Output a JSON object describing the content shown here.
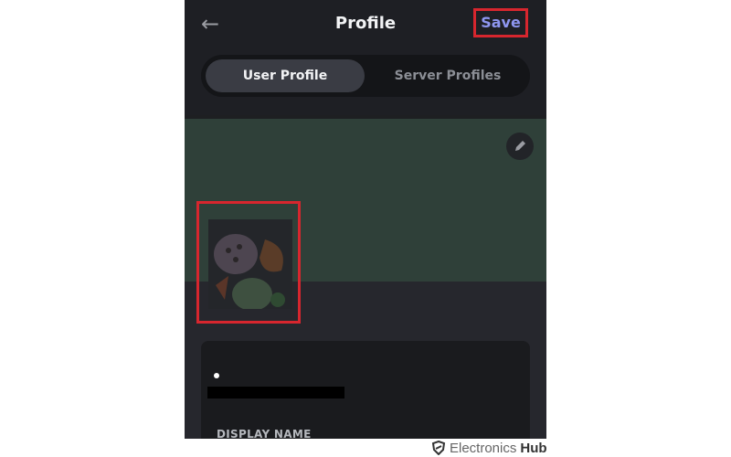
{
  "header": {
    "back_icon": "arrow-left-icon",
    "back_glyph": "←",
    "title": "Profile",
    "save_label": "Save"
  },
  "tabs": [
    {
      "label": "User Profile",
      "active": true
    },
    {
      "label": "Server Profiles",
      "active": false
    }
  ],
  "banner": {
    "edit_icon": "pencil-icon",
    "color": "#2f4039"
  },
  "avatar": {
    "description": "food illustration avatar (lotus root, orange, broccoli)"
  },
  "profile_card": {
    "display_name_label": "DISPLAY NAME"
  },
  "highlight_color": "#d7262e",
  "accent_color": "#8e96f0",
  "watermark": {
    "brand_light": "Electronics",
    "brand_bold": "Hub"
  }
}
